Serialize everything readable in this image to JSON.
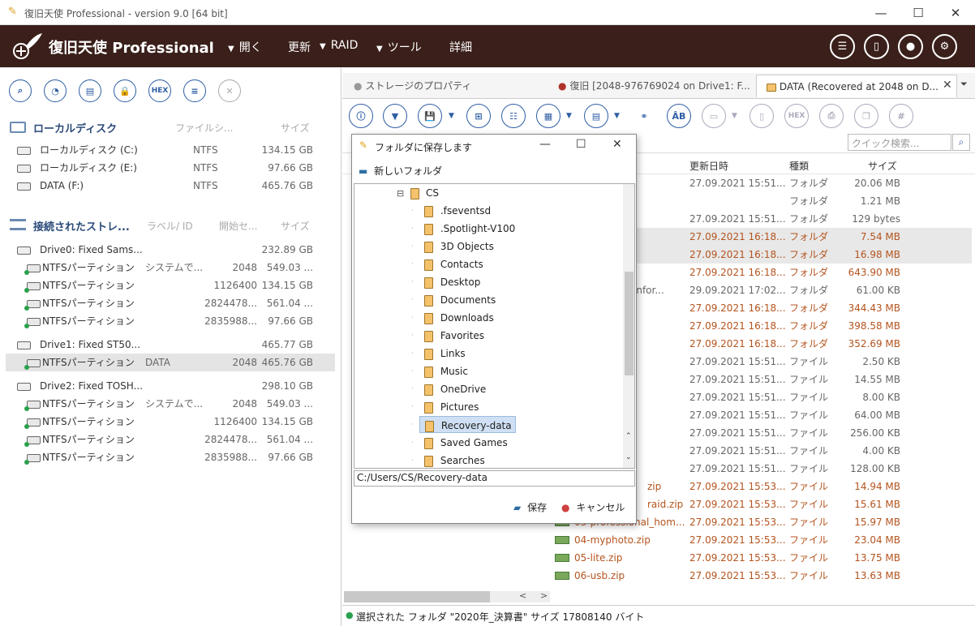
{
  "window": {
    "title": "復旧天使 Professional - version 9.0 [64 bit]",
    "minimize": "—",
    "maximize": "☐",
    "close": "✕"
  },
  "header": {
    "brand": "復旧天使 Professional",
    "menu": [
      {
        "label": "開く",
        "arrow": "▼"
      },
      {
        "label": "更新",
        "arrow": ""
      },
      {
        "label": "RAID",
        "arrow": "▼"
      },
      {
        "label": "ツール",
        "arrow": "▼"
      },
      {
        "label": "詳細",
        "arrow": ""
      }
    ]
  },
  "left": {
    "local_section": {
      "title": "ローカルディスク",
      "col_fs": "ファイルシ...",
      "col_size": "サイズ"
    },
    "local_disks": [
      {
        "name": "ローカルディスク (C:)",
        "fs": "NTFS",
        "size": "134.15 GB"
      },
      {
        "name": "ローカルディスク (E:)",
        "fs": "NTFS",
        "size": "97.66 GB"
      },
      {
        "name": "DATA (F:)",
        "fs": "NTFS",
        "size": "465.76 GB"
      }
    ],
    "storage_section": {
      "title": "接続されたストレ...",
      "col_label": "ラベル/ ID",
      "col_start": "開始セ...",
      "col_size": "サイズ"
    },
    "drives": [
      {
        "name": "Drive0: Fixed Sams...",
        "size": "232.89 GB",
        "parts": [
          {
            "name": "NTFSパーティション",
            "label": "システムで...",
            "start": "2048",
            "size": "549.03 ..."
          },
          {
            "name": "NTFSパーティション",
            "label": "",
            "start": "1126400",
            "size": "134.15 GB"
          },
          {
            "name": "NTFSパーティション",
            "label": "",
            "start": "2824478...",
            "size": "561.04 ..."
          },
          {
            "name": "NTFSパーティション",
            "label": "",
            "start": "2835988...",
            "size": "97.66 GB"
          }
        ]
      },
      {
        "name": "Drive1: Fixed ST50...",
        "size": "465.77 GB",
        "parts": [
          {
            "name": "NTFSパーティション",
            "label": "DATA",
            "start": "2048",
            "size": "465.76 GB"
          }
        ]
      },
      {
        "name": "Drive2: Fixed TOSH...",
        "size": "298.10 GB",
        "parts": [
          {
            "name": "NTFSパーティション",
            "label": "システムで...",
            "start": "2048",
            "size": "549.03 ..."
          },
          {
            "name": "NTFSパーティション",
            "label": "",
            "start": "1126400",
            "size": "134.15 GB"
          },
          {
            "name": "NTFSパーティション",
            "label": "",
            "start": "2824478...",
            "size": "561.04 ..."
          },
          {
            "name": "NTFSパーティション",
            "label": "",
            "start": "2835988...",
            "size": "97.66 GB"
          }
        ]
      }
    ]
  },
  "tabs": [
    {
      "label": "ストレージのプロパティ",
      "dot": "#999999"
    },
    {
      "label": "復旧 [2048-976769024 on Drive1: F...",
      "dot": "#b0322a"
    },
    {
      "label": "DATA (Recovered at 2048 on D...",
      "dot": "#f0a830"
    }
  ],
  "search_placeholder": "クイック検索...",
  "grid": {
    "col_date": "更新日時",
    "col_type": "種類",
    "col_size": "サイズ",
    "rows": [
      {
        "name": "",
        "date": "27.09.2021 15:51...",
        "type": "フォルダ",
        "size": "20.06 MB",
        "style": "normal"
      },
      {
        "name": "",
        "date": "",
        "type": "フォルダ",
        "size": "1.21 MB",
        "style": "normal"
      },
      {
        "name": "N",
        "date": "27.09.2021 15:51...",
        "type": "フォルダ",
        "size": "129 bytes",
        "style": "normal"
      },
      {
        "name": "書",
        "date": "27.09.2021 16:18...",
        "type": "フォルダ",
        "size": "7.54 MB",
        "style": "sel"
      },
      {
        "name": "書",
        "date": "27.09.2021 16:18...",
        "type": "フォルダ",
        "size": "16.98 MB",
        "style": "sel"
      },
      {
        "name": "",
        "date": "27.09.2021 16:18...",
        "type": "フォルダ",
        "size": "643.90 MB",
        "style": "orange"
      },
      {
        "name": "ne Infor...",
        "date": "29.09.2021 17:02...",
        "type": "フォルダ",
        "size": "61.00 KB",
        "style": "normal"
      },
      {
        "name": "",
        "date": "27.09.2021 16:18...",
        "type": "フォルダ",
        "size": "344.43 MB",
        "style": "orange"
      },
      {
        "name": "",
        "date": "27.09.2021 16:18...",
        "type": "フォルダ",
        "size": "398.58 MB",
        "style": "orange"
      },
      {
        "name": "",
        "date": "27.09.2021 16:18...",
        "type": "フォルダ",
        "size": "352.69 MB",
        "style": "orange"
      },
      {
        "name": "",
        "date": "27.09.2021 15:51...",
        "type": "ファイル",
        "size": "2.50 KB",
        "style": "normal"
      },
      {
        "name": "",
        "date": "27.09.2021 15:51...",
        "type": "ファイル",
        "size": "14.55 MB",
        "style": "normal"
      },
      {
        "name": "",
        "date": "27.09.2021 15:51...",
        "type": "ファイル",
        "size": "8.00 KB",
        "style": "normal"
      },
      {
        "name": "",
        "date": "27.09.2021 15:51...",
        "type": "ファイル",
        "size": "64.00 MB",
        "style": "normal"
      },
      {
        "name": "",
        "date": "27.09.2021 15:51...",
        "type": "ファイル",
        "size": "256.00 KB",
        "style": "normal"
      },
      {
        "name": "",
        "date": "27.09.2021 15:51...",
        "type": "ファイル",
        "size": "4.00 KB",
        "style": "normal"
      },
      {
        "name": "",
        "date": "27.09.2021 15:51...",
        "type": "ファイル",
        "size": "128.00 KB",
        "style": "normal"
      },
      {
        "name": "zip",
        "date": "27.09.2021 15:53...",
        "type": "ファイル",
        "size": "14.94 MB",
        "style": "orange"
      },
      {
        "name": "raid.zip",
        "date": "27.09.2021 15:53...",
        "type": "ファイル",
        "size": "15.61 MB",
        "style": "orange"
      },
      {
        "name": "03-professional_hom...",
        "date": "27.09.2021 15:53...",
        "type": "ファイル",
        "size": "15.97 MB",
        "style": "orange"
      },
      {
        "name": "04-myphoto.zip",
        "date": "27.09.2021 15:53...",
        "type": "ファイル",
        "size": "23.04 MB",
        "style": "orange"
      },
      {
        "name": "05-lite.zip",
        "date": "27.09.2021 15:53...",
        "type": "ファイル",
        "size": "13.75 MB",
        "style": "orange"
      },
      {
        "name": "06-usb.zip",
        "date": "27.09.2021 15:53...",
        "type": "ファイル",
        "size": "13.63 MB",
        "style": "orange"
      }
    ]
  },
  "dialog": {
    "title": "フォルダに保存します",
    "new_folder": "新しいフォルダ",
    "root": "CS",
    "folders": [
      ".fseventsd",
      ".Spotlight-V100",
      "3D Objects",
      "Contacts",
      "Desktop",
      "Documents",
      "Downloads",
      "Favorites",
      "Links",
      "Music",
      "OneDrive",
      "Pictures",
      "Recovery-data",
      "Saved Games",
      "Searches"
    ],
    "selected_folder": "Recovery-data",
    "path": "C:/Users/CS/Recovery-data",
    "save": "保存",
    "cancel": "キャンセル"
  },
  "status": {
    "text": "選択された フォルダ \"2020年_決算書\" サイズ 17808140 バイト"
  }
}
